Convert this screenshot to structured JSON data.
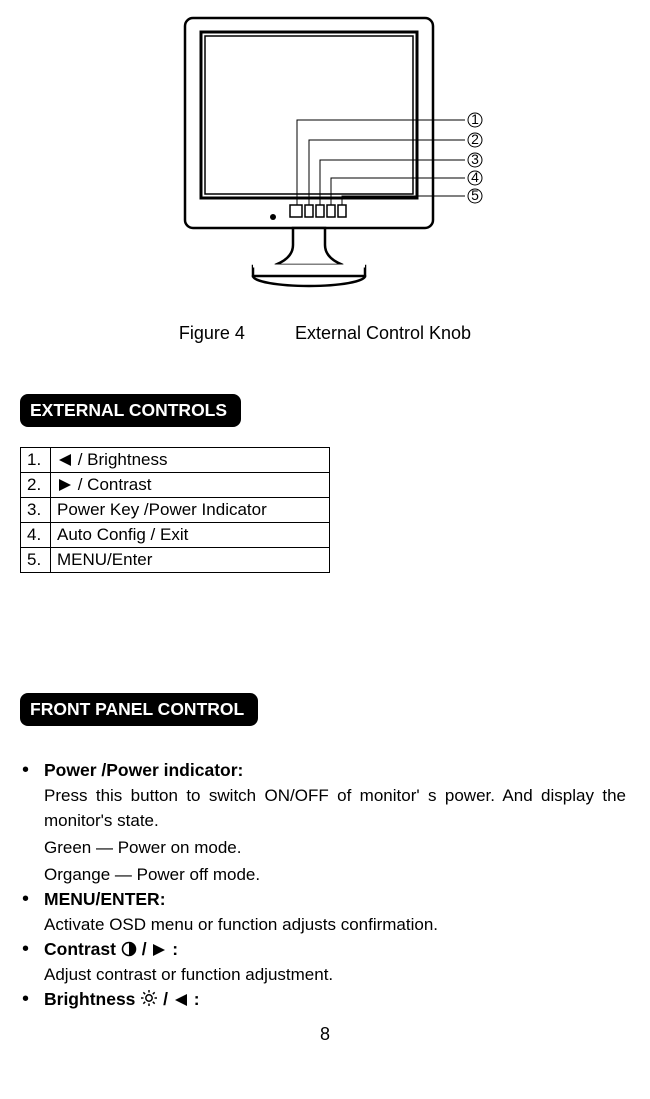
{
  "figure": {
    "label": "Figure 4",
    "title": "External  Control  Knob",
    "callouts": [
      "1",
      "2",
      "3",
      "4",
      "5"
    ]
  },
  "section1": {
    "header": "EXTERNAL CONTROLS",
    "rows": [
      {
        "num": "1.",
        "text": " / Brightness",
        "icon": "triangle-left"
      },
      {
        "num": "2.",
        "text": " / Contrast",
        "icon": "triangle-right"
      },
      {
        "num": "3.",
        "text": "Power Key /Power Indicator"
      },
      {
        "num": "4.",
        "text": "Auto Config / Exit"
      },
      {
        "num": "5.",
        "text": "MENU/Enter"
      }
    ]
  },
  "section2": {
    "header": "FRONT PANEL CONTROL",
    "items": [
      {
        "heading": "Power /Power indicator:",
        "lines": [
          "Press this button to switch ON/OFF of monitor' s power. And display the monitor's state.",
          "Green   —   Power on mode.",
          "Organge  —  Power off mode."
        ]
      },
      {
        "heading": "MENU/ENTER:",
        "lines": [
          "Activate OSD menu or function adjusts confirmation."
        ]
      },
      {
        "heading_pre": "Contrast ",
        "heading_icons": [
          "contrast-icon",
          "slash",
          "triangle-right"
        ],
        "heading_post": " :",
        "lines": [
          "Adjust contrast or function adjustment."
        ]
      },
      {
        "heading_pre": "Brightness ",
        "heading_icons": [
          "brightness-icon",
          "slash",
          "triangle-left"
        ],
        "heading_post": " :",
        "lines": []
      }
    ]
  },
  "page_number": "8"
}
